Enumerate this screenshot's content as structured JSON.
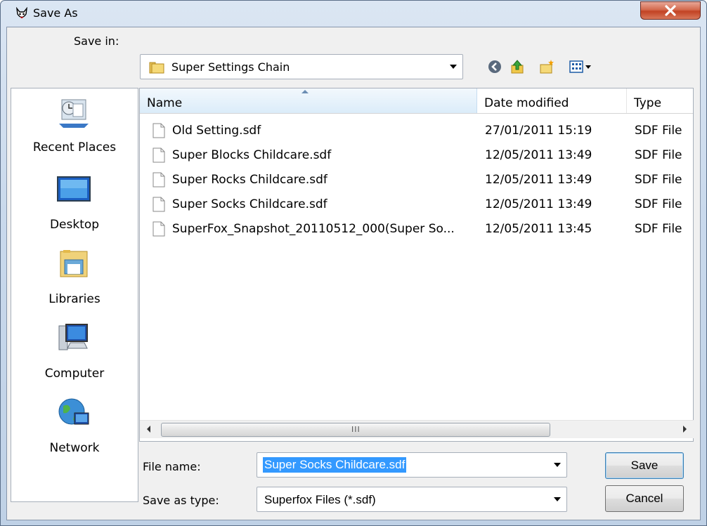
{
  "window": {
    "title": "Save As"
  },
  "save_in": {
    "label": "Save in:",
    "value": "Super Settings Chain"
  },
  "toolbar": {
    "back_icon": "back-arrow-icon",
    "up_icon": "up-folder-icon",
    "new_folder_icon": "new-folder-icon",
    "views_icon": "views-menu-icon"
  },
  "places": [
    {
      "label": "Recent Places",
      "icon": "recent-places-icon"
    },
    {
      "label": "Desktop",
      "icon": "desktop-icon"
    },
    {
      "label": "Libraries",
      "icon": "libraries-icon"
    },
    {
      "label": "Computer",
      "icon": "computer-icon"
    },
    {
      "label": "Network",
      "icon": "network-icon"
    }
  ],
  "columns": {
    "name": "Name",
    "date": "Date modified",
    "type": "Type"
  },
  "files": [
    {
      "name": "Old Setting.sdf",
      "date": "27/01/2011 15:19",
      "type": "SDF File"
    },
    {
      "name": "Super Blocks Childcare.sdf",
      "date": "12/05/2011 13:49",
      "type": "SDF File"
    },
    {
      "name": "Super Rocks Childcare.sdf",
      "date": "12/05/2011 13:49",
      "type": "SDF File"
    },
    {
      "name": "Super Socks Childcare.sdf",
      "date": "12/05/2011 13:49",
      "type": "SDF File"
    },
    {
      "name": "SuperFox_Snapshot_20110512_000(Super So...",
      "date": "12/05/2011 13:45",
      "type": "SDF File"
    }
  ],
  "scrollbar": {
    "grip": "III"
  },
  "file_name": {
    "label": "File name:",
    "value": "Super Socks Childcare.sdf"
  },
  "save_as_type": {
    "label": "Save as type:",
    "value": "Superfox Files (*.sdf)"
  },
  "buttons": {
    "save": "Save",
    "cancel": "Cancel"
  },
  "colors": {
    "selection": "#3399ff",
    "close_button": "#c24223"
  }
}
